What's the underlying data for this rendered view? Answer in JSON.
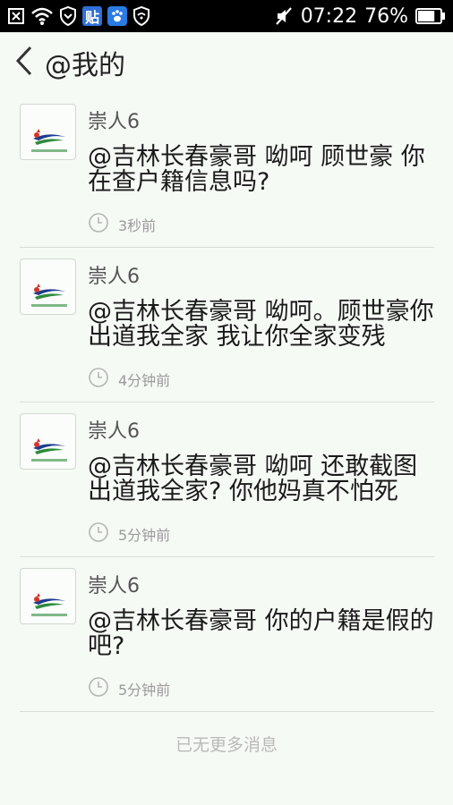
{
  "status_bar": {
    "time": "07:22",
    "battery": "76%",
    "tieba_label": "贴"
  },
  "header": {
    "title": "@我的"
  },
  "messages": [
    {
      "user": "崇人6",
      "text": "@吉林长春豪哥 呦呵 顾世豪 你在查户籍信息吗?",
      "time": "3秒前"
    },
    {
      "user": "崇人6",
      "text": "@吉林长春豪哥 呦呵。顾世豪你出道我全家 我让你全家变残",
      "time": "4分钟前"
    },
    {
      "user": "崇人6",
      "text": "@吉林长春豪哥 呦呵 还敢截图出道我全家? 你他妈真不怕死",
      "time": "5分钟前"
    },
    {
      "user": "崇人6",
      "text": "@吉林长春豪哥 你的户籍是假的吧?",
      "time": "5分钟前"
    }
  ],
  "footer": {
    "no_more": "已无更多消息"
  },
  "colors": {
    "background": "#f6faf5",
    "status_bar": "#000000",
    "divider": "#d9ddd8",
    "muted_text": "#9a9a9a",
    "logo_blue": "#1f3b8f",
    "logo_red": "#d6342b",
    "logo_green": "#2f8a3b"
  },
  "icons": {
    "back": "chevron-left-icon",
    "time": "clock-icon",
    "avatar": "tv-station-logo"
  }
}
